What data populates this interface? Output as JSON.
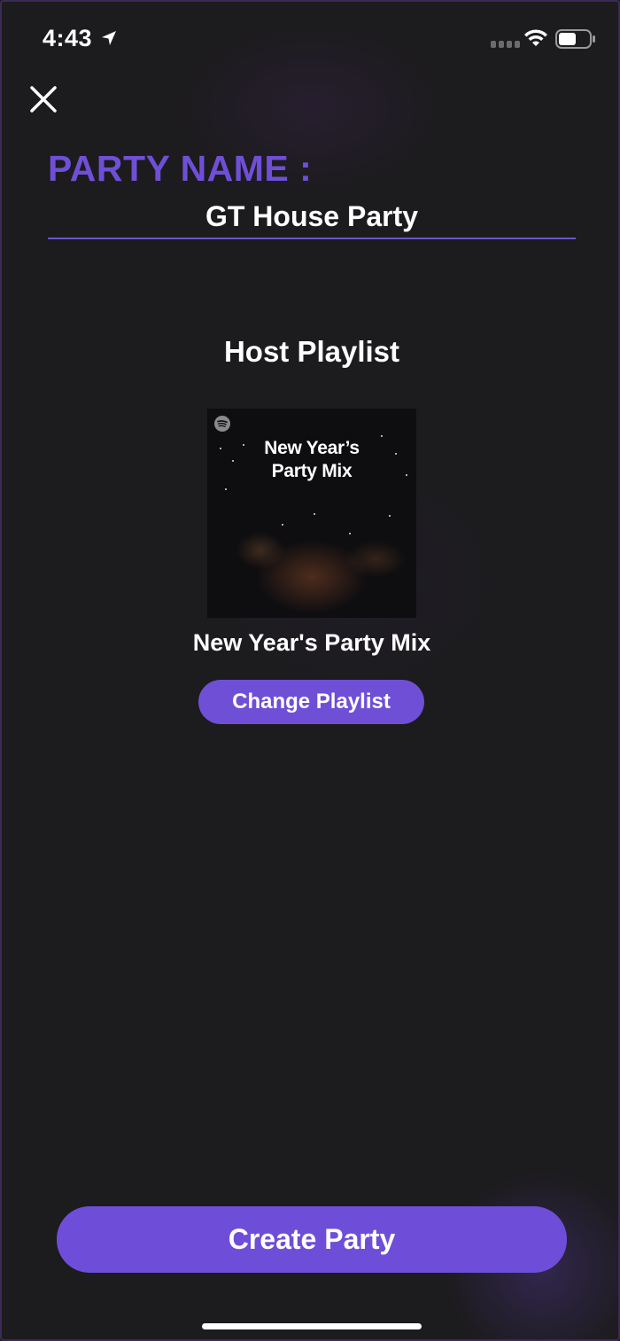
{
  "status_bar": {
    "time": "4:43",
    "location_icon": "location-arrow-icon",
    "signal_icon": "cellular-signal-icon",
    "wifi_icon": "wifi-icon",
    "battery_icon": "battery-icon"
  },
  "header": {
    "close_icon": "close-icon"
  },
  "party": {
    "label": "PARTY NAME :",
    "name_value": "GT House Party"
  },
  "playlist": {
    "section_title": "Host Playlist",
    "cover_line1": "New Year’s",
    "cover_line2": "Party Mix",
    "cover_logo_icon": "spotify-logo-icon",
    "name": "New Year's Party Mix",
    "change_label": "Change Playlist"
  },
  "actions": {
    "create_label": "Create Party"
  },
  "colors": {
    "accent": "#6f4fd6",
    "background": "#1c1b1d",
    "text": "#ffffff"
  }
}
